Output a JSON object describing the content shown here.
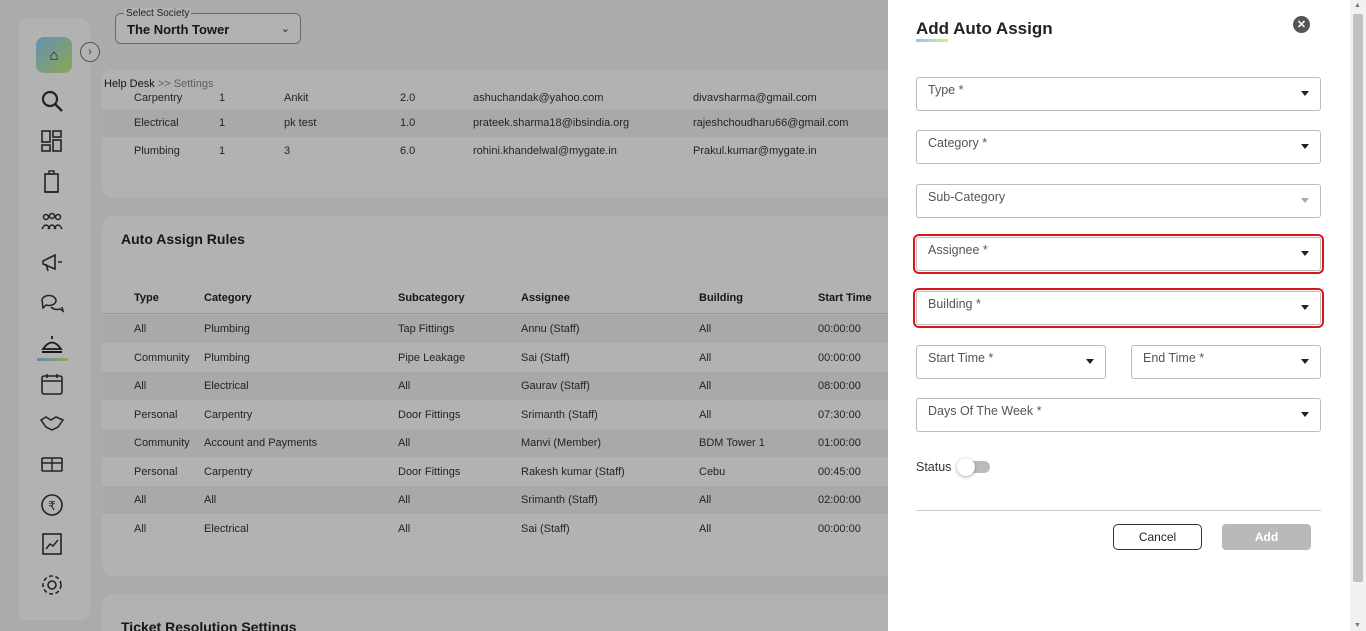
{
  "society": {
    "legend": "Select Society",
    "value": "The North Tower"
  },
  "breadcrumb": {
    "root": "Help Desk",
    "separator": ">>",
    "current": "Settings"
  },
  "escalation_rows": [
    {
      "category": "Carpentry",
      "level": "1",
      "name": "Ankit",
      "time": "2.0",
      "email1": "ashuchandak@yahoo.com",
      "email2": "divavsharma@gmail.com"
    },
    {
      "category": "Electrical",
      "level": "1",
      "name": "pk test",
      "time": "1.0",
      "email1": "prateek.sharma18@ibsindia.org",
      "email2": "rajeshchoudharu66@gmail.com"
    },
    {
      "category": "Plumbing",
      "level": "1",
      "name": "3",
      "time": "6.0",
      "email1": "rohini.khandelwal@mygate.in",
      "email2": "Prakul.kumar@mygate.in"
    }
  ],
  "auto_assign": {
    "title": "Auto Assign Rules",
    "headers": [
      "Type",
      "Category",
      "Subcategory",
      "Assignee",
      "Building",
      "Start Time"
    ],
    "rows": [
      [
        "All",
        "Plumbing",
        "Tap Fittings",
        "Annu (Staff)",
        "All",
        "00:00:00"
      ],
      [
        "Community",
        "Plumbing",
        "Pipe Leakage",
        "Sai (Staff)",
        "All",
        "00:00:00"
      ],
      [
        "All",
        "Electrical",
        "All",
        "Gaurav (Staff)",
        "All",
        "08:00:00"
      ],
      [
        "Personal",
        "Carpentry",
        "Door Fittings",
        "Srimanth (Staff)",
        "All",
        "07:30:00"
      ],
      [
        "Community",
        "Account and Payments",
        "All",
        "Manvi (Member)",
        "BDM Tower 1",
        "01:00:00"
      ],
      [
        "Personal",
        "Carpentry",
        "Door Fittings",
        "Rakesh kumar (Staff)",
        "Cebu",
        "00:45:00"
      ],
      [
        "All",
        "All",
        "All",
        "Srimanth (Staff)",
        "All",
        "02:00:00"
      ],
      [
        "All",
        "Electrical",
        "All",
        "Sai (Staff)",
        "All",
        "00:00:00"
      ]
    ]
  },
  "resolution": {
    "title": "Ticket Resolution Settings"
  },
  "drawer": {
    "title": "Add Auto Assign",
    "fields": {
      "type": "Type *",
      "category": "Category *",
      "sub_category": "Sub-Category",
      "assignee": "Assignee *",
      "building": "Building *",
      "start_time": "Start Time *",
      "end_time": "End Time *",
      "days": "Days Of The Week *"
    },
    "status_label": "Status",
    "status_on": false,
    "cancel_label": "Cancel",
    "add_label": "Add",
    "error_color": "#d9161c"
  }
}
